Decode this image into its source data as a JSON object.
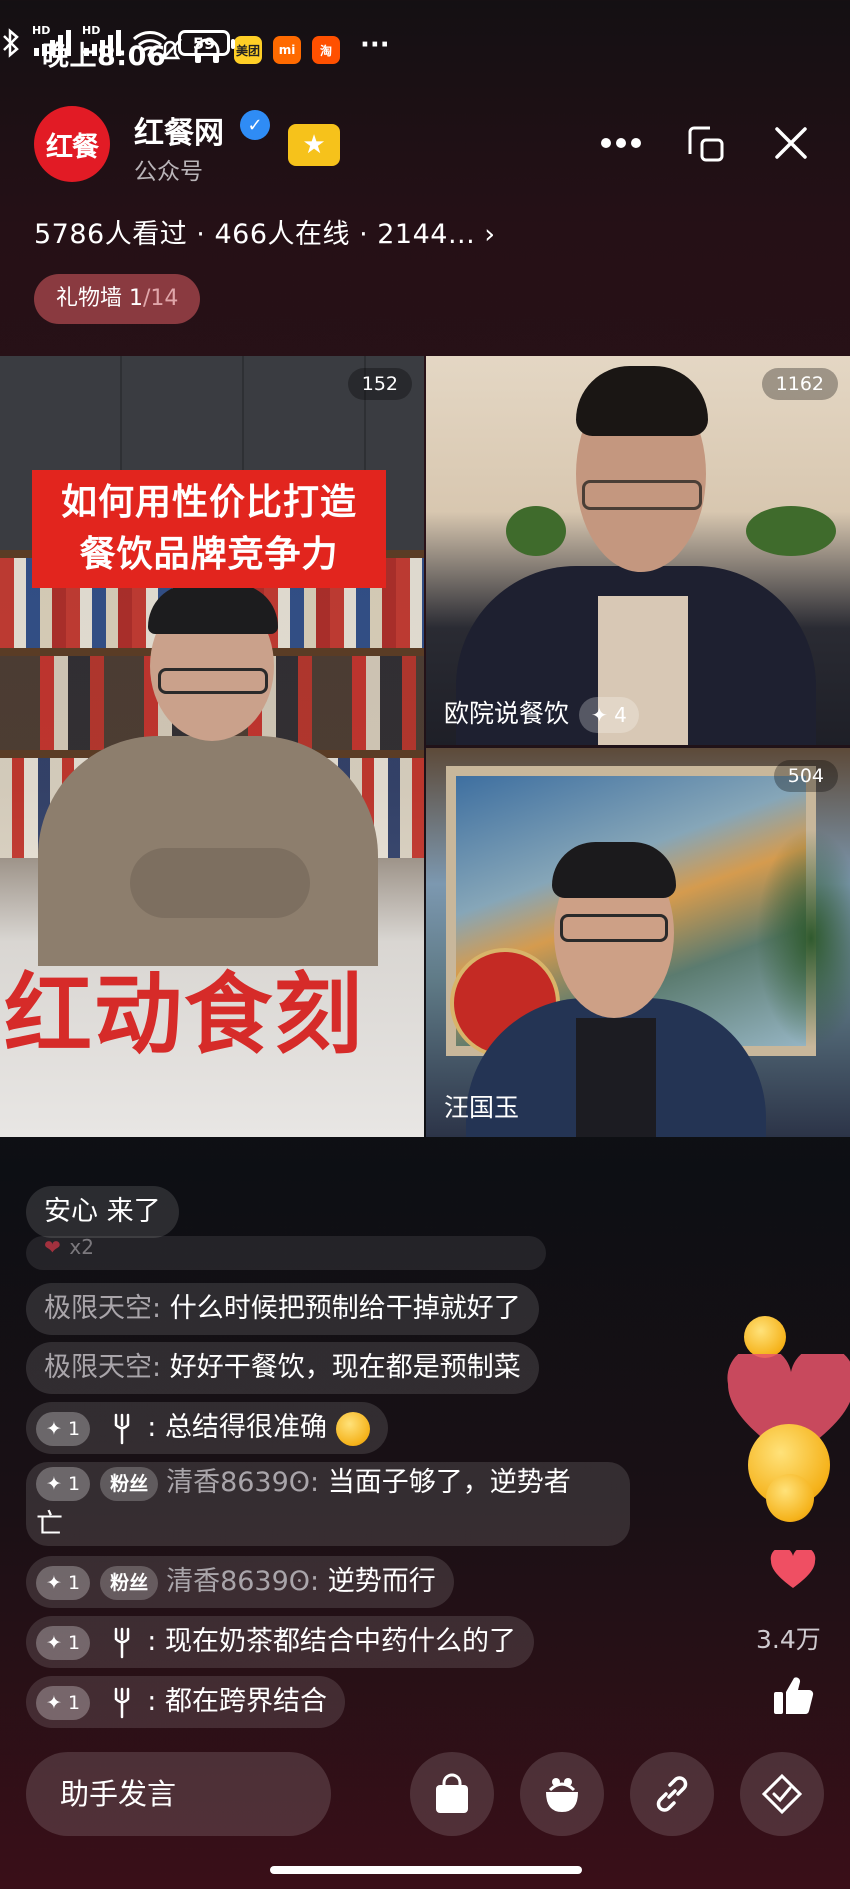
{
  "status_bar": {
    "time": "晚上8:06",
    "app_badges": [
      "美团",
      "mi",
      "淘"
    ],
    "more": "···",
    "signal_label": "HD",
    "battery": "59"
  },
  "header": {
    "logo_text": "红餐",
    "account_name": "红餐网",
    "account_type": "公众号",
    "stats": "5786人看过 · 466人在线 · 2144...",
    "gift_wall_label": "礼物墙",
    "gift_wall_count": " 1",
    "gift_wall_total": "/14"
  },
  "video": {
    "main": {
      "count": "152",
      "title_line1": "如何用性价比打造",
      "title_line2": "餐饮品牌竞争力",
      "sign_text": "红动食刻"
    },
    "guest1": {
      "count": "1162",
      "name": "欧院说餐饮",
      "likes": "✦ 4"
    },
    "guest2": {
      "count": "504",
      "name": "汪国玉"
    }
  },
  "comments": {
    "join_notice": "安心 来了",
    "gift_notice": "x2",
    "items": [
      {
        "user": "极限天空:",
        "text": " 什么时候把预制给干掉就好了"
      },
      {
        "user": "极限天空:",
        "text": " 好好干餐饮，现在都是预制菜"
      },
      {
        "level": "✦ 1",
        "user": ":",
        "text": " 总结得很准确"
      },
      {
        "level": "✦ 1",
        "badge": "粉丝",
        "user": "清香8639ʘ:",
        "text": " 当面子够了，逆势者",
        "text2": "亡"
      },
      {
        "level": "✦ 1",
        "badge": "粉丝",
        "user": "清香8639ʘ:",
        "text": " 逆势而行"
      },
      {
        "level": "✦ 1",
        "user": ":",
        "text": " 现在奶茶都结合中药什么的了"
      },
      {
        "level": "✦ 1",
        "user": ":",
        "text": " 都在跨界结合"
      }
    ]
  },
  "side": {
    "like_count": "3.4万"
  },
  "bottom_bar": {
    "assistant_placeholder": "助手发言"
  },
  "colors": {
    "brand_red": "#e21b25",
    "verified_blue": "#2f8cf5",
    "badge_yellow": "#f6c21b"
  }
}
